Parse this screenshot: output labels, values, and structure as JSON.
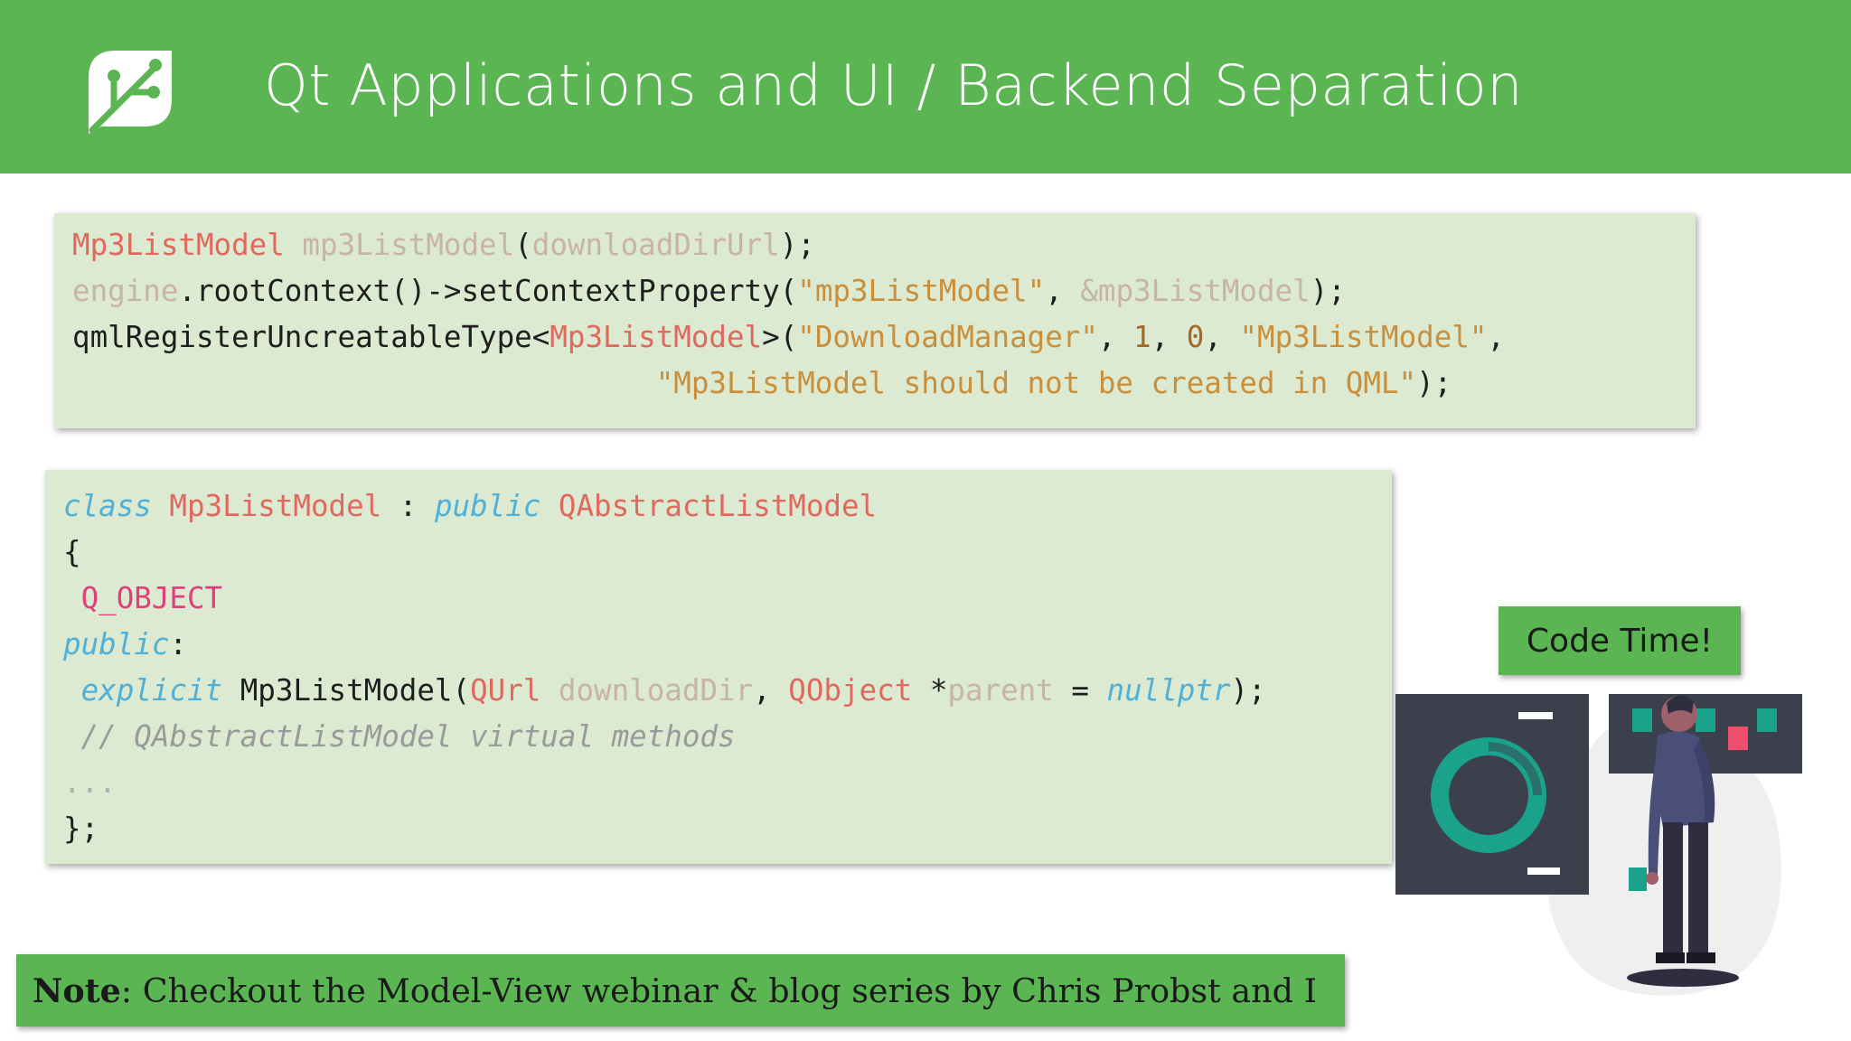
{
  "header": {
    "title": "Qt Applications and UI / Backend Separation",
    "logo_icon": "leaf-circuit-icon",
    "color": "#5bb553"
  },
  "code_block_1": {
    "lines": [
      [
        {
          "text": "Mp3ListModel",
          "cls": "t"
        },
        {
          "text": " ",
          "cls": ""
        },
        {
          "text": "mp3ListModel",
          "cls": "v"
        },
        {
          "text": "(",
          "cls": ""
        },
        {
          "text": "downloadDirUrl",
          "cls": "v"
        },
        {
          "text": ");",
          "cls": ""
        }
      ],
      [
        {
          "text": "engine",
          "cls": "v"
        },
        {
          "text": ".rootContext()->setContextProperty(",
          "cls": ""
        },
        {
          "text": "\"mp3ListModel\"",
          "cls": "s"
        },
        {
          "text": ", ",
          "cls": ""
        },
        {
          "text": "&mp3ListModel",
          "cls": "v"
        },
        {
          "text": ");",
          "cls": ""
        }
      ],
      [
        {
          "text": "qmlRegisterUncreatableType<",
          "cls": ""
        },
        {
          "text": "Mp3ListModel",
          "cls": "t"
        },
        {
          "text": ">(",
          "cls": ""
        },
        {
          "text": "\"DownloadManager\"",
          "cls": "s"
        },
        {
          "text": ", ",
          "cls": ""
        },
        {
          "text": "1",
          "cls": "n"
        },
        {
          "text": ", ",
          "cls": ""
        },
        {
          "text": "0",
          "cls": "n"
        },
        {
          "text": ", ",
          "cls": ""
        },
        {
          "text": "\"Mp3ListModel\"",
          "cls": "s"
        },
        {
          "text": ",",
          "cls": ""
        }
      ],
      [
        {
          "text": "                                 ",
          "cls": ""
        },
        {
          "text": "\"Mp3ListModel should not be created in QML\"",
          "cls": "s"
        },
        {
          "text": ");",
          "cls": ""
        }
      ]
    ]
  },
  "code_block_2": {
    "lines": [
      [
        {
          "text": "class",
          "cls": "k"
        },
        {
          "text": " ",
          "cls": ""
        },
        {
          "text": "Mp3ListModel",
          "cls": "t"
        },
        {
          "text": " : ",
          "cls": ""
        },
        {
          "text": "public",
          "cls": "k"
        },
        {
          "text": " ",
          "cls": ""
        },
        {
          "text": "QAbstractListModel",
          "cls": "t"
        }
      ],
      [
        {
          "text": "{",
          "cls": ""
        }
      ],
      [
        {
          "text": " ",
          "cls": ""
        },
        {
          "text": "Q_OBJECT",
          "cls": "m"
        }
      ],
      [
        {
          "text": "public",
          "cls": "k"
        },
        {
          "text": ":",
          "cls": ""
        }
      ],
      [
        {
          "text": " ",
          "cls": ""
        },
        {
          "text": "explicit",
          "cls": "k"
        },
        {
          "text": " Mp3ListModel(",
          "cls": ""
        },
        {
          "text": "QUrl",
          "cls": "t"
        },
        {
          "text": " ",
          "cls": ""
        },
        {
          "text": "downloadDir",
          "cls": "v"
        },
        {
          "text": ", ",
          "cls": ""
        },
        {
          "text": "QObject",
          "cls": "t"
        },
        {
          "text": " *",
          "cls": ""
        },
        {
          "text": "parent",
          "cls": "v"
        },
        {
          "text": " = ",
          "cls": ""
        },
        {
          "text": "nullptr",
          "cls": "k"
        },
        {
          "text": ");",
          "cls": ""
        }
      ],
      [
        {
          "text": " ",
          "cls": ""
        },
        {
          "text": "// QAbstractListModel virtual methods",
          "cls": "c"
        }
      ],
      [
        {
          "text": "...",
          "cls": "e"
        }
      ],
      [
        {
          "text": "};",
          "cls": ""
        }
      ]
    ]
  },
  "code_time": {
    "label": "Code Time!"
  },
  "note": {
    "label": "Note",
    "text": ": Checkout the Model-View webinar & blog series by Chris Probst and I"
  },
  "illustration": {
    "icon": "person-viewing-dashboard-illustration"
  }
}
